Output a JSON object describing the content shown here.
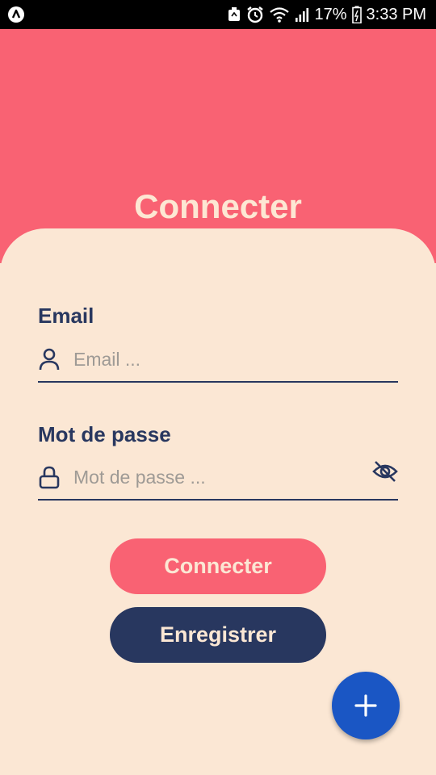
{
  "status_bar": {
    "battery": "17%",
    "time": "3:33 PM"
  },
  "header": {
    "title": "Connecter"
  },
  "form": {
    "email": {
      "label": "Email",
      "placeholder": "Email ...",
      "icon": "user-icon"
    },
    "password": {
      "label": "Mot de passe",
      "placeholder": "Mot de passe ...",
      "icon": "lock-icon",
      "toggle_icon": "eye-off-icon"
    }
  },
  "buttons": {
    "login": "Connecter",
    "register": "Enregistrer"
  },
  "fab": {
    "icon": "plus-icon"
  },
  "colors": {
    "header_bg": "#F96273",
    "card_bg": "#FBE7D4",
    "primary_dark": "#28375F",
    "fab_bg": "#1A56C4"
  }
}
